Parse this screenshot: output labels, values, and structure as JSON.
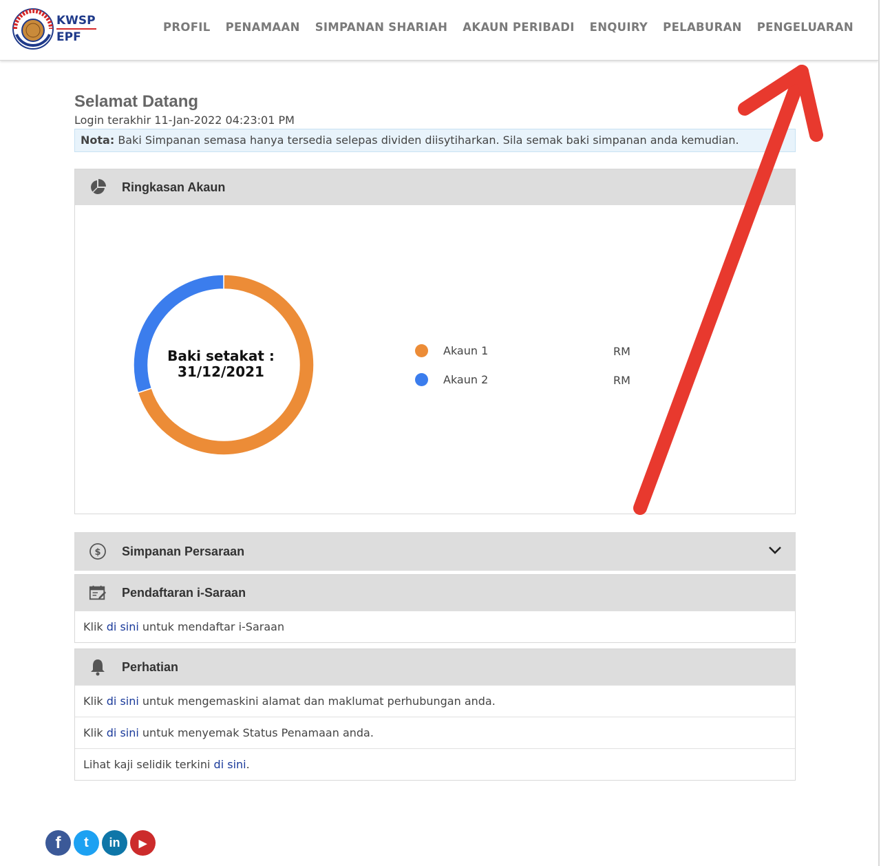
{
  "brand": {
    "line1": "KWSP",
    "line2": "EPF",
    "seal_label": "KWSP"
  },
  "nav": {
    "items": [
      "PROFIL",
      "PENAMAAN",
      "SIMPANAN SHARIAH",
      "AKAUN PERIBADI",
      "ENQUIRY",
      "PELABURAN",
      "PENGELUARAN"
    ]
  },
  "welcome": {
    "title": "Selamat Datang",
    "last_login": "Login terakhir 11-Jan-2022 04:23:01 PM",
    "nota_label": "Nota:",
    "nota_text": "Baki Simpanan semasa hanya tersedia selepas dividen diisytiharkan. Sila semak baki simpanan anda kemudian."
  },
  "summary": {
    "title": "Ringkasan Akaun",
    "icon": "pie-chart-icon",
    "center_line1": "Baki setakat :",
    "center_line2": "31/12/2021",
    "legend": [
      {
        "label": "Akaun 1",
        "currency": "RM"
      },
      {
        "label": "Akaun 2",
        "currency": "RM"
      }
    ]
  },
  "chart_data": {
    "type": "pie",
    "categories": [
      "Akaun 1",
      "Akaun 2"
    ],
    "values": [
      70,
      30
    ],
    "colors": [
      "#ec8c37",
      "#3b7ded"
    ],
    "donut": true,
    "legend": "right"
  },
  "retirement": {
    "title": "Simpanan Persaraan",
    "icon": "dollar-coin-icon"
  },
  "isaraan": {
    "title": "Pendaftaran i-Saraan",
    "icon": "calendar-edit-icon",
    "row": {
      "pre": "Klik",
      "link": "di sini",
      "post": "untuk mendaftar i-Saraan"
    }
  },
  "perhatian": {
    "title": "Perhatian",
    "icon": "bell-icon",
    "rows": [
      {
        "pre": "Klik",
        "link": "di sini",
        "post": "untuk mengemaskini alamat dan maklumat perhubungan anda."
      },
      {
        "pre": "Klik",
        "link": "di sini",
        "post": "untuk menyemak Status Penamaan anda."
      },
      {
        "pre": "Lihat kaji selidik terkini",
        "link": "di sini",
        "post": "."
      }
    ]
  },
  "social": {
    "facebook": "f",
    "twitter": "t",
    "linkedin": "in",
    "youtube": "▶"
  },
  "colors": {
    "accent_orange": "#ec8c37",
    "accent_blue": "#3b7ded",
    "annotation_red": "#e8392e",
    "link": "#1a3a9a"
  }
}
